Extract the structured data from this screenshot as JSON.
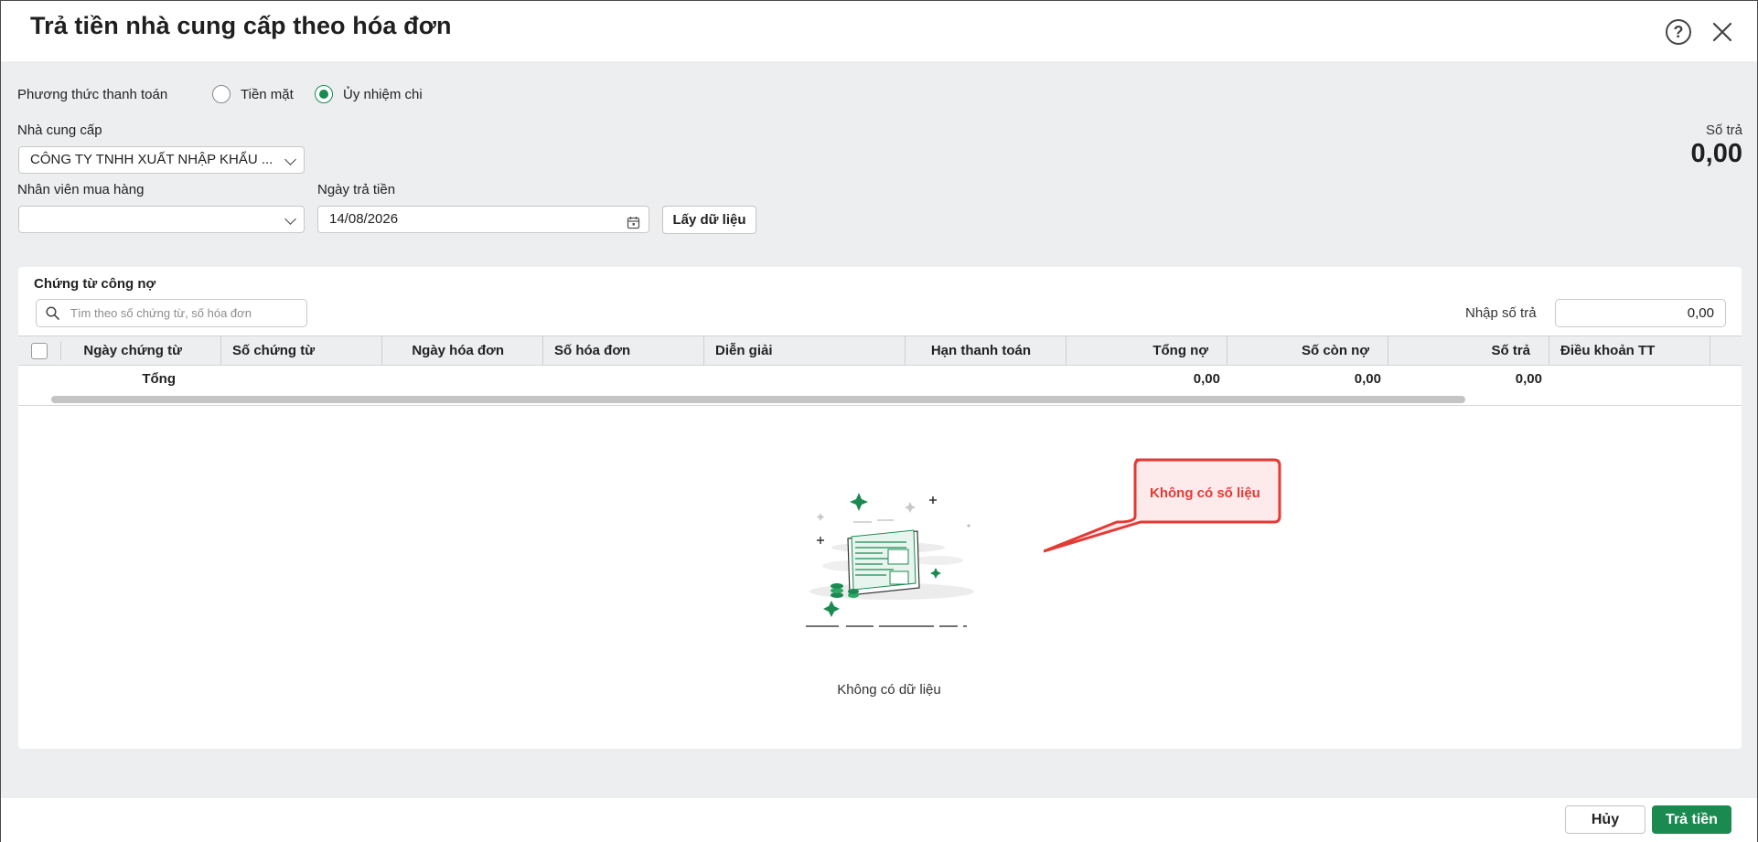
{
  "dialog": {
    "title": "Trả tiền nhà cung cấp theo hóa đơn",
    "help_icon": "question-circle-icon",
    "close_icon": "close-icon"
  },
  "payment_method": {
    "label": "Phương thức thanh toán",
    "options": [
      {
        "label": "Tiền mặt",
        "checked": false
      },
      {
        "label": "Ủy nhiệm chi",
        "checked": true
      }
    ]
  },
  "supplier": {
    "label": "Nhà cung cấp",
    "value": "CÔNG TY TNHH XUẤT NHẬP KHẨU ..."
  },
  "purchaser": {
    "label": "Nhân viên mua hàng",
    "value": ""
  },
  "payment_date": {
    "label": "Ngày trả tiền",
    "value": "14/08/2026"
  },
  "fetch_button": "Lấy dữ liệu",
  "paid_summary": {
    "label": "Số trả",
    "value": "0,00"
  },
  "debt_docs": {
    "title": "Chứng từ công nợ",
    "search_placeholder": "Tìm theo số chứng từ, số hóa đơn",
    "amount_label": "Nhập số trả",
    "amount_value": "0,00",
    "columns": [
      "Ngày chứng từ",
      "Số chứng từ",
      "Ngày hóa đơn",
      "Số hóa đơn",
      "Diễn giải",
      "Hạn thanh toán",
      "Tổng nợ",
      "Số còn nợ",
      "Số trả",
      "Điều khoản TT"
    ],
    "total_row": {
      "label": "Tổng",
      "total_debt": "0,00",
      "remaining": "0,00",
      "paid": "0,00"
    },
    "empty_text": "Không có dữ liệu"
  },
  "annotation": {
    "text": "Không có số liệu",
    "color": "#e33a36"
  },
  "footer": {
    "cancel": "Hủy",
    "pay": "Trả tiền"
  },
  "colors": {
    "accent": "#1a8a50",
    "background": "#edeef0"
  }
}
